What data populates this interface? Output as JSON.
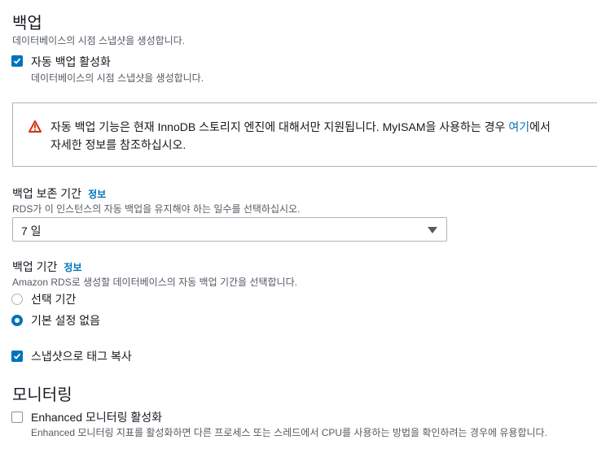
{
  "backup": {
    "title": "백업",
    "description": "데이터베이스의 시점 스냅샷을 생성합니다.",
    "auto_backup": {
      "label": "자동 백업 활성화",
      "description": "데이터베이스의 시점 스냅샷을 생성합니다.",
      "checked": true
    },
    "alert": {
      "text_before_link": "자동 백업 기능은 현재 InnoDB 스토리지 엔진에 대해서만 지원됩니다. MyISAM을 사용하는 경우 ",
      "link_text": "여기",
      "text_after_link": "에서",
      "line2": "자세한 정보를 참조하십시오."
    },
    "retention": {
      "label": "백업 보존 기간",
      "info": "정보",
      "description": "RDS가 이 인스턴스의 자동 백업을 유지해야 하는 일수를 선택하십시오.",
      "value": "7 일"
    },
    "window": {
      "label": "백업 기간",
      "info": "정보",
      "description": "Amazon RDS로 생성할 데이터베이스의 자동 백업 기간을 선택합니다.",
      "options": [
        {
          "label": "선택 기간",
          "selected": false
        },
        {
          "label": "기본 설정 없음",
          "selected": true
        }
      ]
    },
    "copy_tags": {
      "label": "스냅샷으로 태그 복사",
      "checked": true
    }
  },
  "monitoring": {
    "title": "모니터링",
    "enhanced": {
      "label": "Enhanced 모니터링 활성화",
      "description": "Enhanced 모니터링 지표를 활성화하면 다른 프로세스 또는 스레드에서 CPU를 사용하는 방법을 확인하려는 경우에 유용합니다.",
      "checked": false
    }
  },
  "colors": {
    "accent": "#0073bb",
    "warning": "#d13212",
    "text": "#16191f",
    "muted": "#545b64"
  }
}
